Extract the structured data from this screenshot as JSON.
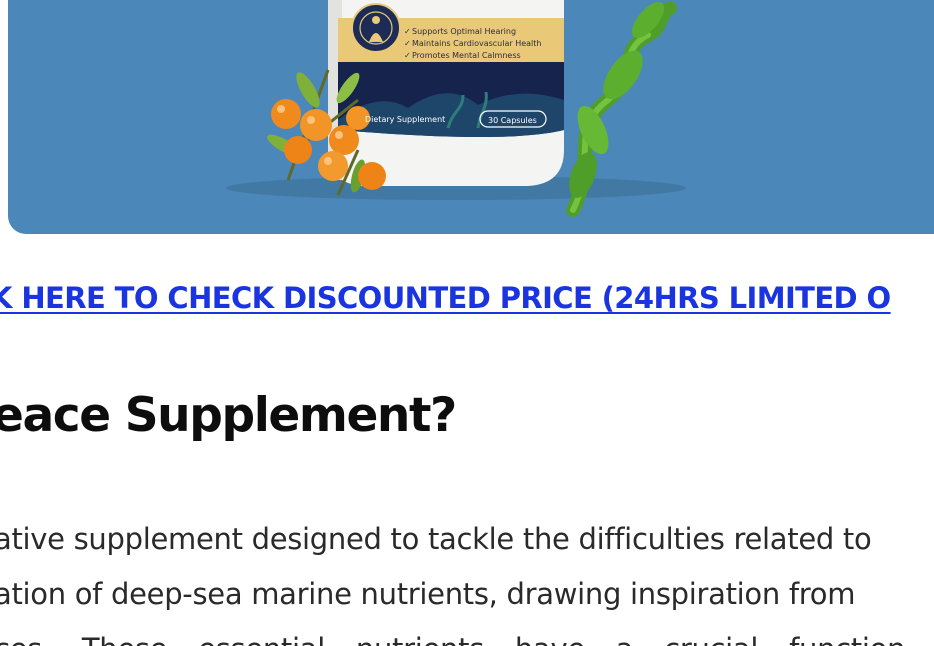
{
  "hero": {
    "label_benefits": [
      "Supports Optimal Hearing",
      "Maintains Cardiovascular Health",
      "Promotes Mental Calmness"
    ],
    "label_type": "Dietary Supplement",
    "label_count": "30 Capsules",
    "colors": {
      "background": "#4c87b9",
      "label_gold": "#e9c877",
      "label_navy": "#16244d",
      "berry": "#f08a1c",
      "seaweed": "#5cae2e"
    }
  },
  "cta": {
    "text": "K HERE TO CHECK DISCOUNTED PRICE (24HRS LIMITED O",
    "color": "#1a35e0"
  },
  "heading": {
    "text": "eace Supplement?"
  },
  "body": {
    "lines": [
      "ative supplement designed to tackle the difficulties related to",
      "ation of deep-sea marine nutrients, drawing inspiration from",
      "ces. These essential nutrients have a crucial function in"
    ]
  }
}
